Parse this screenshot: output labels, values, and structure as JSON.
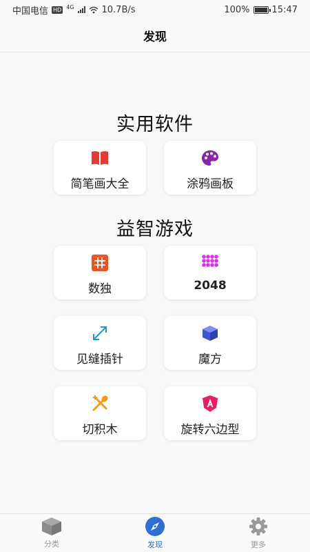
{
  "status_bar": {
    "carrier": "中国电信",
    "hd": "HD",
    "network": "4G",
    "speed": "10.7B/s",
    "battery": "100%",
    "time": "15:47"
  },
  "header": {
    "title": "发现"
  },
  "sections": [
    {
      "title": "实用软件",
      "items": [
        {
          "label": "简笔画大全",
          "icon": "book-icon",
          "color": "#e53935"
        },
        {
          "label": "涂鸦画板",
          "icon": "palette-icon",
          "color": "#8e24aa"
        }
      ]
    },
    {
      "title": "益智游戏",
      "items": [
        {
          "label": "数独",
          "icon": "grid-icon",
          "color": "#f4511e"
        },
        {
          "label": "2048",
          "icon": "dots-grid-icon",
          "color": "#d633e6"
        },
        {
          "label": "见缝插针",
          "icon": "expand-arrows-icon",
          "color": "#1e9ad6"
        },
        {
          "label": "魔方",
          "icon": "cube-icon",
          "color": "#4a64e0"
        },
        {
          "label": "切积木",
          "icon": "crossed-tools-icon",
          "color": "#f39c12"
        },
        {
          "label": "旋转六边型",
          "icon": "angular-shield-icon",
          "color": "#e91e63"
        }
      ]
    }
  ],
  "tabs": [
    {
      "label": "分类",
      "icon": "box-icon",
      "active": false
    },
    {
      "label": "发现",
      "icon": "compass-icon",
      "active": true
    },
    {
      "label": "更多",
      "icon": "gear-icon",
      "active": false
    }
  ],
  "colors": {
    "accent": "#2d6fd6",
    "inactive": "#9a9a9a",
    "background": "#f9f9f9"
  }
}
